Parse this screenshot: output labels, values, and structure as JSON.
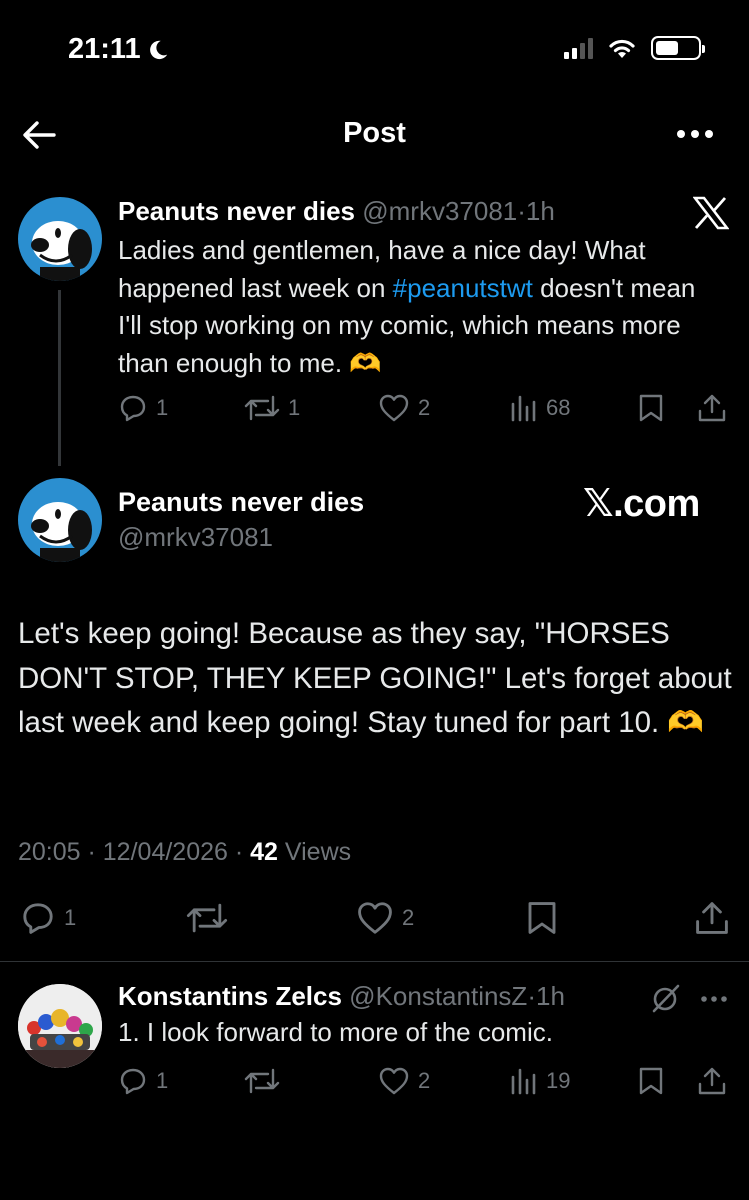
{
  "status_bar": {
    "time": "21:11"
  },
  "nav": {
    "title": "Post"
  },
  "parent_tweet": {
    "display_name": "Peanuts never dies",
    "handle": "@mrkv37081",
    "sep": "·",
    "age": "1h",
    "text_before": "Ladies and gentlemen, have a nice day! What happened last week on ",
    "hashtag": "#peanutstwt",
    "text_after": " doesn't mean I'll stop working on my comic, which means more than enough to me. 🫶",
    "reply_count": "1",
    "repost_count": "1",
    "like_count": "2",
    "view_count": "68"
  },
  "main_tweet": {
    "display_name": "Peanuts never dies",
    "handle": "@mrkv37081",
    "watermark": "𝕏.com",
    "text": "Let's keep going! Because as they say, \"HORSES DON'T STOP, THEY KEEP GOING!\" Let's forget about last week and keep going! Stay tuned for part 10. 🫶",
    "time": "20:05",
    "date": "12/04/2026",
    "views_value": "42",
    "views_label": "Views",
    "reply_count": "1",
    "like_count": "2"
  },
  "reply_tweet": {
    "display_name": "Konstantins Zelcs",
    "handle": "@KonstantinsZ",
    "sep": "·",
    "age": "1h",
    "text": "1. I look forward to more of the comic.",
    "reply_count": "1",
    "like_count": "2",
    "view_count": "19"
  },
  "colors": {
    "accent": "#1d9bf0",
    "muted": "#71767b",
    "background": "#000000",
    "divider": "#2f3336"
  }
}
